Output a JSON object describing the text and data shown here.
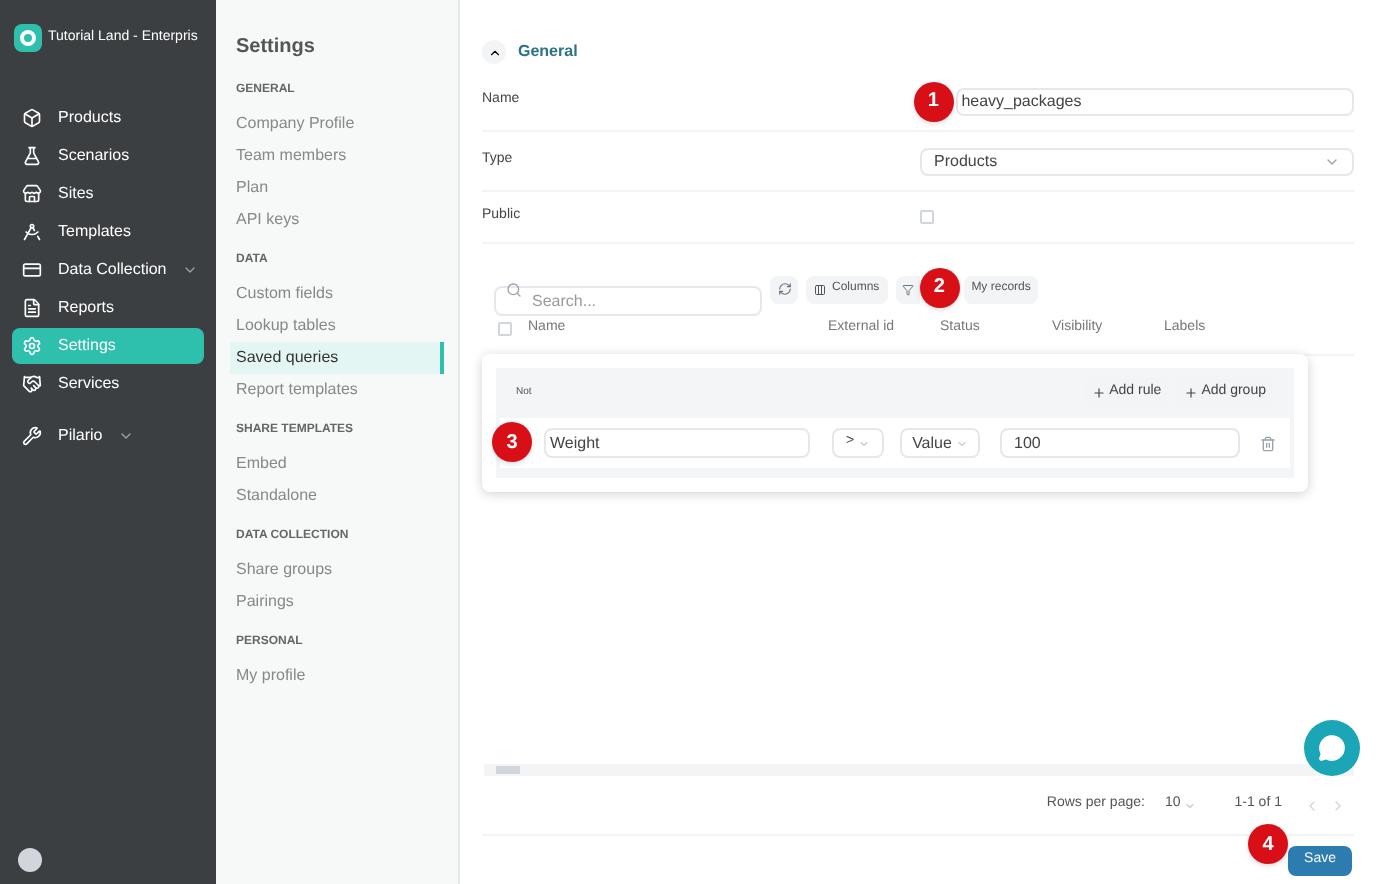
{
  "app": {
    "title": "Tutorial Land - Enterpris"
  },
  "nav": [
    {
      "label": "Products",
      "selected": false
    },
    {
      "label": "Scenarios",
      "selected": false
    },
    {
      "label": "Sites",
      "selected": false
    },
    {
      "label": "Templates",
      "selected": false
    },
    {
      "label": "Data Collection",
      "selected": false,
      "expanded": false
    },
    {
      "label": "Reports",
      "selected": false
    },
    {
      "label": "Settings",
      "selected": true
    },
    {
      "label": "Services",
      "selected": false
    }
  ],
  "nav_extra": {
    "label": "Pilario",
    "expanded": false
  },
  "settings_menu": {
    "title": "Settings",
    "sections": [
      {
        "heading": "GENERAL",
        "items": [
          {
            "label": "Company Profile",
            "selected": false
          },
          {
            "label": "Team members",
            "selected": false
          },
          {
            "label": "Plan",
            "selected": false
          },
          {
            "label": "API keys",
            "selected": false
          }
        ]
      },
      {
        "heading": "DATA",
        "items": [
          {
            "label": "Custom fields",
            "selected": false
          },
          {
            "label": "Lookup tables",
            "selected": false
          },
          {
            "label": "Saved queries",
            "selected": true
          },
          {
            "label": "Report templates",
            "selected": false
          }
        ]
      },
      {
        "heading": "SHARE TEMPLATES",
        "items": [
          {
            "label": "Embed",
            "selected": false
          },
          {
            "label": "Standalone",
            "selected": false
          }
        ]
      },
      {
        "heading": "DATA COLLECTION",
        "items": [
          {
            "label": "Share groups",
            "selected": false
          },
          {
            "label": "Pairings",
            "selected": false
          }
        ]
      },
      {
        "heading": "PERSONAL",
        "items": [
          {
            "label": "My profile",
            "selected": false
          }
        ]
      }
    ]
  },
  "general": {
    "title": "General",
    "expanded": true,
    "name": {
      "label": "Name",
      "value": "heavy_packages"
    },
    "type": {
      "label": "Type",
      "value": "Products"
    },
    "public": {
      "label": "Public",
      "checked": false
    }
  },
  "toolbar": {
    "search_placeholder": "Search...",
    "columns": "Columns",
    "my_records": "My records"
  },
  "table": {
    "all_checked": false,
    "columns": [
      "Name",
      "External id",
      "Status",
      "Visibility",
      "Labels"
    ]
  },
  "filter": {
    "group_label": "Not",
    "add_rule": "Add rule",
    "add_group": "Add group",
    "rule": {
      "field": "Weight",
      "operator": ">",
      "source": "Value",
      "value": "100"
    }
  },
  "pagination": {
    "rows_per_page_label": "Rows per page:",
    "rows_per_page": "10",
    "range": "1-1 of 1"
  },
  "save": "Save",
  "callouts": [
    "1",
    "2",
    "3",
    "4"
  ]
}
